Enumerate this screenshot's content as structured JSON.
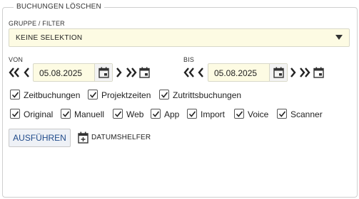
{
  "section": {
    "title": "BUCHUNGEN LÖSCHEN"
  },
  "filter": {
    "label": "GRUPPE / FILTER",
    "value": "KEINE SELEKTION"
  },
  "from": {
    "label": "VON",
    "date": "05.08.2025"
  },
  "to": {
    "label": "BIS",
    "date": "05.08.2025"
  },
  "types": [
    {
      "label": "Zeitbuchungen",
      "checked": true
    },
    {
      "label": "Projektzeiten",
      "checked": true
    },
    {
      "label": "Zutrittsbuchungen",
      "checked": true
    }
  ],
  "sources": [
    {
      "label": "Original",
      "checked": true
    },
    {
      "label": "Manuell",
      "checked": true
    },
    {
      "label": "Web",
      "checked": true
    },
    {
      "label": "App",
      "checked": true
    },
    {
      "label": "Import",
      "checked": true
    },
    {
      "label": "Voice",
      "checked": true
    },
    {
      "label": "Scanner",
      "checked": true
    }
  ],
  "actions": {
    "execute_label": "AUSFÜHREN",
    "date_helper_label": "DATUMSHELFER"
  }
}
